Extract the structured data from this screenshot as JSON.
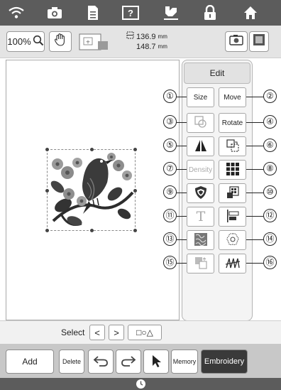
{
  "top_icons": [
    "wifi-icon",
    "camera-icon",
    "document-icon",
    "help-icon",
    "thread-icon",
    "lock-icon",
    "home-icon"
  ],
  "toolbar": {
    "zoom": "100%",
    "width_value": "136.9",
    "height_value": "148.7",
    "unit": "mm"
  },
  "panel": {
    "tab": "Edit",
    "buttons": [
      {
        "num": "①",
        "label": "Size"
      },
      {
        "num": "②",
        "label": "Move"
      },
      {
        "num": "③",
        "label": "",
        "icon": "outline-icon"
      },
      {
        "num": "④",
        "label": "Rotate"
      },
      {
        "num": "⑤",
        "label": "",
        "icon": "flip-icon"
      },
      {
        "num": "⑥",
        "label": "",
        "icon": "duplicate-icon"
      },
      {
        "num": "⑦",
        "label": "Density"
      },
      {
        "num": "⑧",
        "label": "",
        "icon": "border-grid-icon"
      },
      {
        "num": "⑨",
        "label": "",
        "icon": "applique-icon"
      },
      {
        "num": "⑩",
        "label": "",
        "icon": "group-icon"
      },
      {
        "num": "⑪",
        "label": "",
        "icon": "text-icon"
      },
      {
        "num": "⑫",
        "label": "",
        "icon": "align-icon"
      },
      {
        "num": "⑬",
        "label": "",
        "icon": "stipple-icon"
      },
      {
        "num": "⑭",
        "label": "",
        "icon": "motif-icon"
      },
      {
        "num": "⑮",
        "label": "",
        "icon": "order-icon"
      },
      {
        "num": "⑯",
        "label": "",
        "icon": "stitch-icon"
      }
    ]
  },
  "select_bar": {
    "label": "Select",
    "prev": "<",
    "next": ">",
    "shapes": "□○△"
  },
  "bottom": {
    "add": "Add",
    "delete": "Delete",
    "memory": "Memory",
    "embroidery": "Embroidery"
  }
}
